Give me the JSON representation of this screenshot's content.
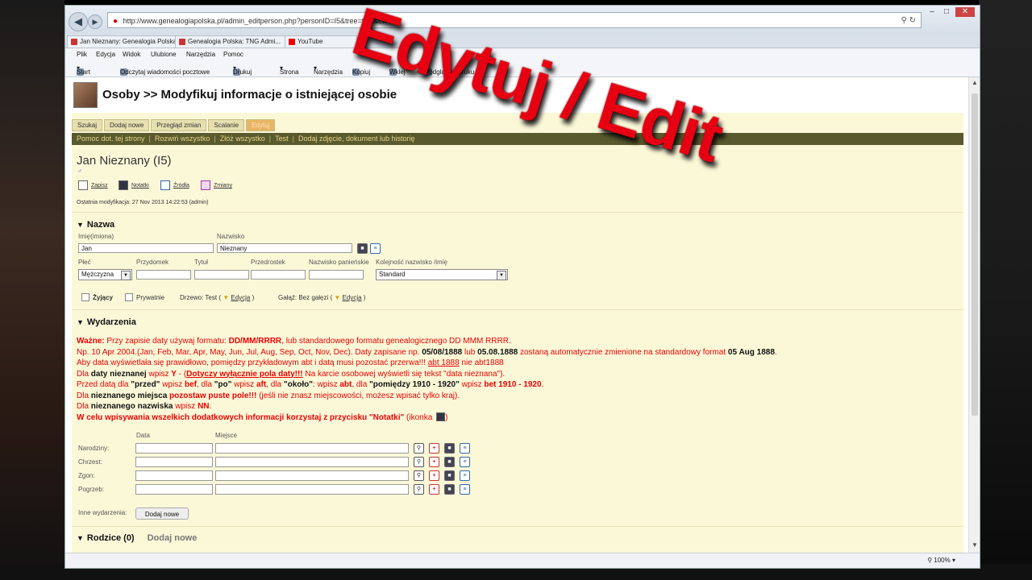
{
  "browser": {
    "url": "http://www.genealogiapolska.pl/admin_editperson.php?personID=I5&tree=test&cw=1",
    "tabs": [
      {
        "label": "Jan Nieznany: Genealogia Polska"
      },
      {
        "label": "Genealogia Polska: TNG Admi..."
      },
      {
        "label": "YouTube"
      }
    ],
    "menu": [
      "Plik",
      "Edycja",
      "Widok",
      "Ulubione",
      "Narzędzia",
      "Pomoc"
    ],
    "toolbar": [
      "Start",
      "Odczytaj wiadomości pocztowe",
      "Drukuj",
      "Strona",
      "Narzędzia",
      "Kopiuj",
      "Wklej",
      "Podgląd wydruku"
    ],
    "zoom": "100%"
  },
  "overlay_text": "Edytuj / Edit",
  "page": {
    "title": "Osoby >> Modyfikuj informacje o istniejącej osobie",
    "subnav": [
      {
        "label": "Szukaj",
        "active": false
      },
      {
        "label": "Dodaj nowe",
        "active": false
      },
      {
        "label": "Przegląd zmian",
        "active": false
      },
      {
        "label": "Scalanie",
        "active": false
      },
      {
        "label": "Edytuj",
        "active": true
      }
    ],
    "actions": [
      "Pomoc dot. tej strony",
      "Rozwiń wszystko",
      "Złóż wszystko",
      "Test",
      "Dodaj zdjęcie, dokument lub historię"
    ],
    "person_name": "Jan Nieznany (I5)",
    "sex_symbol": "♂",
    "icons": [
      {
        "label": "Zapisz"
      },
      {
        "label": "Notatki"
      },
      {
        "label": "Źródła"
      },
      {
        "label": "Zmiany"
      }
    ],
    "last_modified": "Ostatnia modyfikacja: 27 Nov 2013 14:22:53 (admin)"
  },
  "name_section": {
    "heading": "Nazwa",
    "given_label": "Imię(imiona)",
    "given_value": "Jan",
    "surname_label": "Nazwisko",
    "surname_value": "Nieznany",
    "sex_label": "Płeć",
    "sex_value": "Mężczyzna",
    "nickname_label": "Przydomek",
    "title_label": "Tytuł",
    "prefix_label": "Przedrostek",
    "maiden_label": "Nazwisko panieńskie",
    "order_label": "Kolejność nazwisko /imię",
    "order_value": "Standard",
    "living_label": "Żyjący",
    "private_label": "Prywatnie",
    "tree_label": "Drzewo: Test",
    "tree_edit": "Edycja",
    "branch_label": "Gałąź: Bez gałęzi",
    "branch_edit": "Edycja"
  },
  "events_section": {
    "heading": "Wydarzenia",
    "instructions": {
      "l1_a": "Ważne:",
      "l1_b": " Przy zapisie daty używaj formatu: ",
      "l1_c": "DD/MM/RRRR",
      "l1_d": ", lub standardowego formatu genealogicznego DD MMM RRRR.",
      "l2_a": "Np. 10 Apr 2004.(Jan, Feb, Mar, Apr, May, Jun, Jul, Aug, Sep, Oct, Nov, Dec). Daty zapisane np. ",
      "l2_b": "05/08/1888",
      "l2_c": " lub ",
      "l2_d": "05.08.1888",
      "l2_e": " zostaną automatycznie zmienione na standardowy format ",
      "l2_f": "05 Aug 1888",
      "l2_g": ".",
      "l3_a": "Aby data wyświetlała się prawidłowo, pomiędzy przykładowym abt i datą musi pozostać przerwa!!! ",
      "l3_b": "abt 1888",
      "l3_c": " nie abt1888",
      "l4_a": "Dla ",
      "l4_b": "daty nieznanej",
      "l4_c": " wpisz ",
      "l4_d": "Y",
      "l4_e": " - (",
      "l4_f": "Dotyczy wyłącznie pola daty!!!",
      "l4_g": " Na karcie osobowej wyświetli się tekst \"data nieznana\").",
      "l5_a": "Przed datą dla ",
      "l5_b": "\"przed\"",
      "l5_c": " wpisz ",
      "l5_d": "bef",
      "l5_e": ", dla ",
      "l5_f": "\"po\"",
      "l5_g": " wpisz ",
      "l5_h": "aft",
      "l5_i": ", dla ",
      "l5_j": "\"około\"",
      "l5_k": ": wpisz ",
      "l5_l": "abt",
      "l5_m": ", dla ",
      "l5_n": "\"pomiędzy 1910 - 1920\"",
      "l5_o": " wpisz ",
      "l5_p": "bet 1910 - 1920",
      "l5_q": ".",
      "l6_a": "Dla ",
      "l6_b": "nieznanego miejsca",
      "l6_c": " pozostaw puste pole!!!",
      "l6_d": " (jeśli nie znasz miejscowości, możesz wpisać tylko kraj).",
      "l7_a": "Dla ",
      "l7_b": "nieznanego nazwiska",
      "l7_c": " wpisz ",
      "l7_d": "NN",
      "l7_e": ".",
      "l8_a": "W celu wpisywania wszelkich dodatkowych informacji korzystaj z przycisku \"Notatki\"",
      "l8_b": " (ikonka "
    },
    "date_label": "Data",
    "place_label": "Miejsce",
    "events": [
      {
        "label": "Narodziny:"
      },
      {
        "label": "Chrzest:"
      },
      {
        "label": "Zgon:"
      },
      {
        "label": "Pogrzeb:"
      }
    ],
    "other_label": "Inne wydarzenia:",
    "add_button": "Dodaj nowe"
  },
  "parents_section": {
    "heading": "Rodzice (0)",
    "add_label": "Dodaj nowe"
  },
  "colors": {
    "page_bg": "#fbf8d8",
    "action_bar": "#595a2d",
    "overlay_red": "#e60012",
    "instruction_red": "#e00000"
  }
}
